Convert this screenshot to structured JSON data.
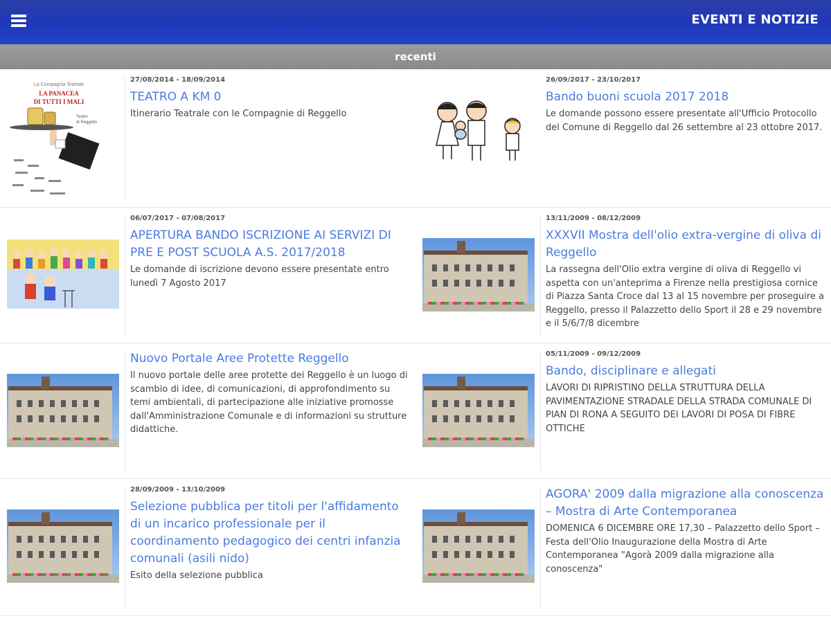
{
  "header": {
    "title": "EVENTI E NOTIZIE"
  },
  "subheader": {
    "label": "recenti"
  },
  "items": [
    {
      "date": "27/08/2014 - 18/09/2014",
      "title": "TEATRO A KM 0",
      "desc": "Itinerario Teatrale con le Compagnie di Reggello",
      "poster_text": "LA PANACEA DI TUTTI I MALI"
    },
    {
      "date": "26/09/2017 - 23/10/2017",
      "title": "Bando buoni scuola 2017 2018",
      "desc": "Le domande possono essere presentate all'Ufficio Protocollo del Comune di Reggello dal 26 settembre al 23 ottobre 2017."
    },
    {
      "date": "06/07/2017 - 07/08/2017",
      "title": "APERTURA BANDO ISCRIZIONE AI SERVIZI DI PRE E POST SCUOLA A.S. 2017/2018",
      "desc": "Le domande di iscrizione devono essere presentate entro lunedì 7 Agosto 2017"
    },
    {
      "date": "13/11/2009 - 08/12/2009",
      "title": "XXXVII Mostra dell'olio extra-vergine di oliva di Reggello",
      "desc": "La rassegna dell'Olio extra vergine di oliva di Reggello vi aspetta con un'anteprima a Firenze nella prestigiosa cornice di Piazza Santa Croce dal 13 al 15 novembre per proseguire a Reggello, presso il Palazzetto dello Sport il 28 e 29 novembre e il 5/6/7/8 dicembre"
    },
    {
      "date": "",
      "title": "Nuovo Portale Aree Protette Reggello",
      "desc": "Il nuovo portale delle aree protette dei Reggello è un luogo di scambio di idee, di comunicazioni, di approfondimento su temi ambientali, di partecipazione alle iniziative promosse dall'Amministrazione Comunale e di informazioni su strutture didattiche."
    },
    {
      "date": "05/11/2009 - 09/12/2009",
      "title": "Bando, disciplinare e allegati",
      "desc": "LAVORI DI RIPRISTINO DELLA STRUTTURA DELLA PAVIMENTAZIONE STRADALE DELLA STRADA COMUNALE DI PIAN DI RONA A SEGUITO DEI LAVORI DI POSA DI FIBRE OTTICHE"
    },
    {
      "date": "28/09/2009 - 13/10/2009",
      "title": "Selezione pubblica per titoli per l'affidamento di un incarico professionale per il coordinamento pedagogico dei centri infanzia comunali (asili nido)",
      "desc": "Esito della selezione pubblica"
    },
    {
      "date": "",
      "title": "AGORA' 2009 dalla migrazione alla conoscenza – Mostra di Arte Contemporanea",
      "desc": "DOMENICA 6 DICEMBRE ORE 17,30 – Palazzetto dello Sport – Festa dell'Olio Inaugurazione della Mostra di Arte Contemporanea \"Agorà 2009 dalla migrazione alla conoscenza\""
    }
  ]
}
